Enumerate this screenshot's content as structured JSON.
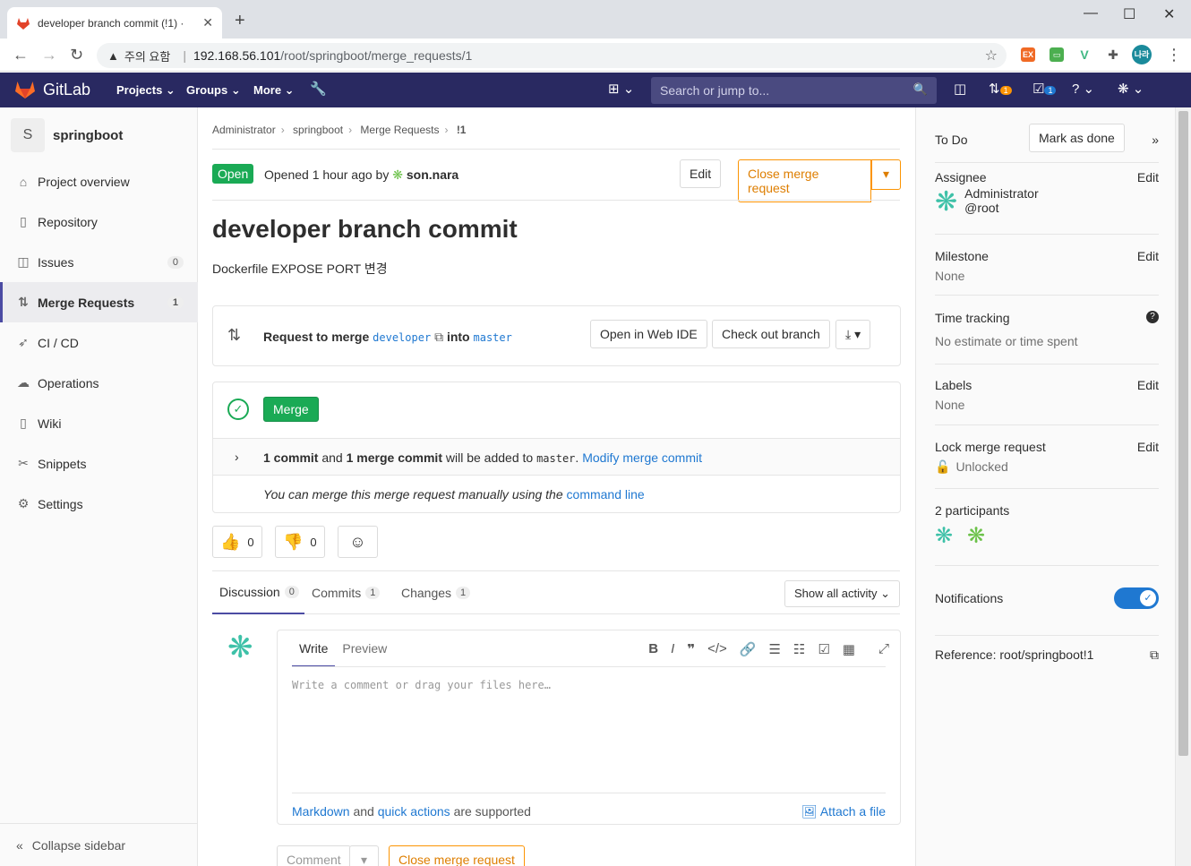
{
  "browser": {
    "tab_title": "developer branch commit (!1) · ",
    "warning": "주의 요함",
    "url_host": "192.168.56.101",
    "url_path": "/root/springboot/merge_requests/1"
  },
  "topnav": {
    "brand": "GitLab",
    "menus": [
      "Projects",
      "Groups",
      "More"
    ],
    "search_placeholder": "Search or jump to...",
    "mr_count": "1",
    "todo_count": "1"
  },
  "sidebar": {
    "project_initial": "S",
    "project_name": "springboot",
    "items": [
      {
        "label": "Project overview",
        "icon": "home-icon"
      },
      {
        "label": "Repository",
        "icon": "book-icon"
      },
      {
        "label": "Issues",
        "icon": "issues-icon",
        "count": "0"
      },
      {
        "label": "Merge Requests",
        "icon": "merge-request-icon",
        "count": "1"
      },
      {
        "label": "CI / CD",
        "icon": "rocket-icon"
      },
      {
        "label": "Operations",
        "icon": "cloud-icon"
      },
      {
        "label": "Wiki",
        "icon": "book-icon"
      },
      {
        "label": "Snippets",
        "icon": "scissors-icon"
      },
      {
        "label": "Settings",
        "icon": "gear-icon"
      }
    ],
    "collapse": "Collapse sidebar"
  },
  "breadcrumb": [
    "Administrator",
    "springboot",
    "Merge Requests",
    "!1"
  ],
  "mr": {
    "status": "Open",
    "opened_text": "Opened 1 hour ago by",
    "author": "son.nara",
    "edit": "Edit",
    "close": "Close merge request",
    "title": "developer branch commit",
    "description": "Dockerfile EXPOSE PORT 변경",
    "request_to_merge": "Request to merge",
    "source_branch": "developer",
    "into": "into",
    "target_branch": "master",
    "open_web_ide": "Open in Web IDE",
    "checkout_branch": "Check out branch",
    "merge_button": "Merge",
    "commit_info_1": "1 commit",
    "commit_info_and": "and",
    "commit_info_2": "1 merge commit",
    "commit_info_rest": "will be added to",
    "commit_info_branch": "master",
    "modify_commit": "Modify merge commit",
    "manual_text": "You can merge this merge request manually using the",
    "command_line": "command line",
    "thumbsup_count": "0",
    "thumbsdown_count": "0"
  },
  "tabs": [
    {
      "label": "Discussion",
      "count": "0"
    },
    {
      "label": "Commits",
      "count": "1"
    },
    {
      "label": "Changes",
      "count": "1"
    }
  ],
  "show_all_activity": "Show all activity",
  "editor": {
    "write": "Write",
    "preview": "Preview",
    "placeholder": "Write a comment or drag your files here…",
    "markdown": "Markdown",
    "and": "and",
    "quick_actions": "quick actions",
    "supported": "are supported",
    "attach": "Attach a file",
    "comment_button": "Comment",
    "close_button": "Close merge request"
  },
  "right_sidebar": {
    "todo": "To Do",
    "mark_done": "Mark as done",
    "assignee_label": "Assignee",
    "assignee_name": "Administrator",
    "assignee_user": "@root",
    "milestone_label": "Milestone",
    "milestone_value": "None",
    "time_label": "Time tracking",
    "time_value": "No estimate or time spent",
    "labels_label": "Labels",
    "labels_value": "None",
    "lock_label": "Lock merge request",
    "lock_value": "Unlocked",
    "participants": "2 participants",
    "notifications": "Notifications",
    "reference": "Reference: root/springboot!1",
    "edit": "Edit"
  }
}
